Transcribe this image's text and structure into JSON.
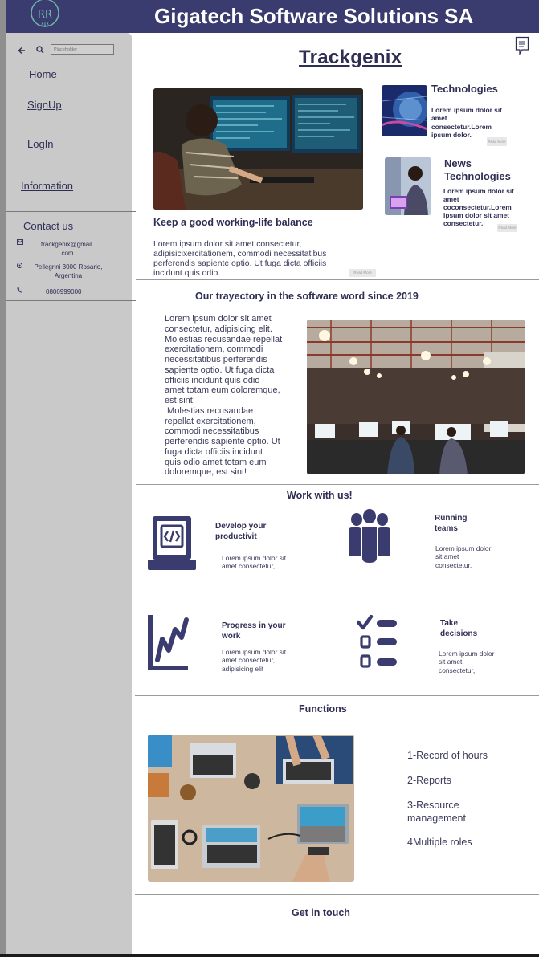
{
  "header": {
    "title": "Gigatech Software Solutions SA"
  },
  "sidebar": {
    "search_placeholder": "Placeholder",
    "nav": [
      "Home",
      "SignUp",
      "LogIn",
      "Information"
    ],
    "contact_title": "Contact us",
    "email": [
      "trackgenix@gmail.",
      "com"
    ],
    "address": [
      "Pellegrini 3000 Rosario,",
      "Argentina"
    ],
    "phone": "0800999000"
  },
  "main": {
    "title": "Trackgenix",
    "hero": {
      "heading": "Keep a good working-life balance",
      "body": [
        "Lorem ipsum dolor sit amet consectetur,",
        "adipisicixercitationem, commodi necessitatibus",
        "perferendis sapiente optio. Ut fuga dicta officiis",
        "incidunt quis odio"
      ],
      "read_more": "Read More"
    },
    "side_news": [
      {
        "title": [
          "Technologies"
        ],
        "body": [
          "Lorem ipsum dolor sit",
          "amet",
          "consectetur.Lorem",
          "ipsum dolor."
        ],
        "read_more": "Read More"
      },
      {
        "title": [
          "News",
          "Technologies"
        ],
        "body": [
          "Lorem ipsum dolor sit",
          "amet",
          "coconsectetur.Lorem",
          "ipsum dolor sit amet",
          "consectetur."
        ],
        "read_more": "Read More"
      }
    ],
    "trajectory": {
      "heading": "Our trayectory in the software word since 2019",
      "body": [
        "Lorem ipsum dolor sit amet",
        "consectetur, adipisicing elit.",
        "Molestias recusandae repellat",
        "exercitationem, commodi",
        "necessitatibus perferendis",
        "sapiente optio. Ut fuga dicta",
        "officiis incidunt quis odio",
        "amet totam eum doloremque,",
        "est sint!",
        " Molestias recusandae",
        "repellat exercitationem,",
        "commodi necessitatibus",
        "perferendis sapiente optio. Ut",
        "fuga dicta officiis incidunt",
        "quis odio amet totam eum",
        "doloremque, est sint!"
      ]
    },
    "work": {
      "heading": "Work with us!",
      "items": [
        {
          "icon": "laptop-code-icon",
          "title": [
            "Develop your",
            "productivit"
          ],
          "body": [
            "Lorem ipsum dolor sit",
            "amet consectetur,"
          ]
        },
        {
          "icon": "team-icon",
          "title": [
            "Running",
            "teams"
          ],
          "body": [
            "Lorem ipsum dolor",
            "sit amet",
            "consectetur,"
          ]
        },
        {
          "icon": "growth-chart-icon",
          "title": [
            "Progress in your",
            "work"
          ],
          "body": [
            "Lorem ipsum dolor sit",
            "amet consectetur,",
            "adipisicing elit"
          ]
        },
        {
          "icon": "checklist-icon",
          "title": [
            "Take",
            "decisions"
          ],
          "body": [
            "Lorem ipsum dolor",
            "sit amet",
            "consectetur,"
          ]
        }
      ]
    },
    "functions": {
      "heading": "Functions",
      "items": [
        "1-Record of hours",
        "2-Reports",
        "3-Resource",
        "management",
        "4Multiple roles"
      ]
    },
    "contact": {
      "heading": "Get in touch"
    }
  },
  "colors": {
    "header": "#3a3b6e",
    "sidebar": "#c9c9c9",
    "text": "#2f2e54",
    "icon": "#3a3b6e"
  }
}
